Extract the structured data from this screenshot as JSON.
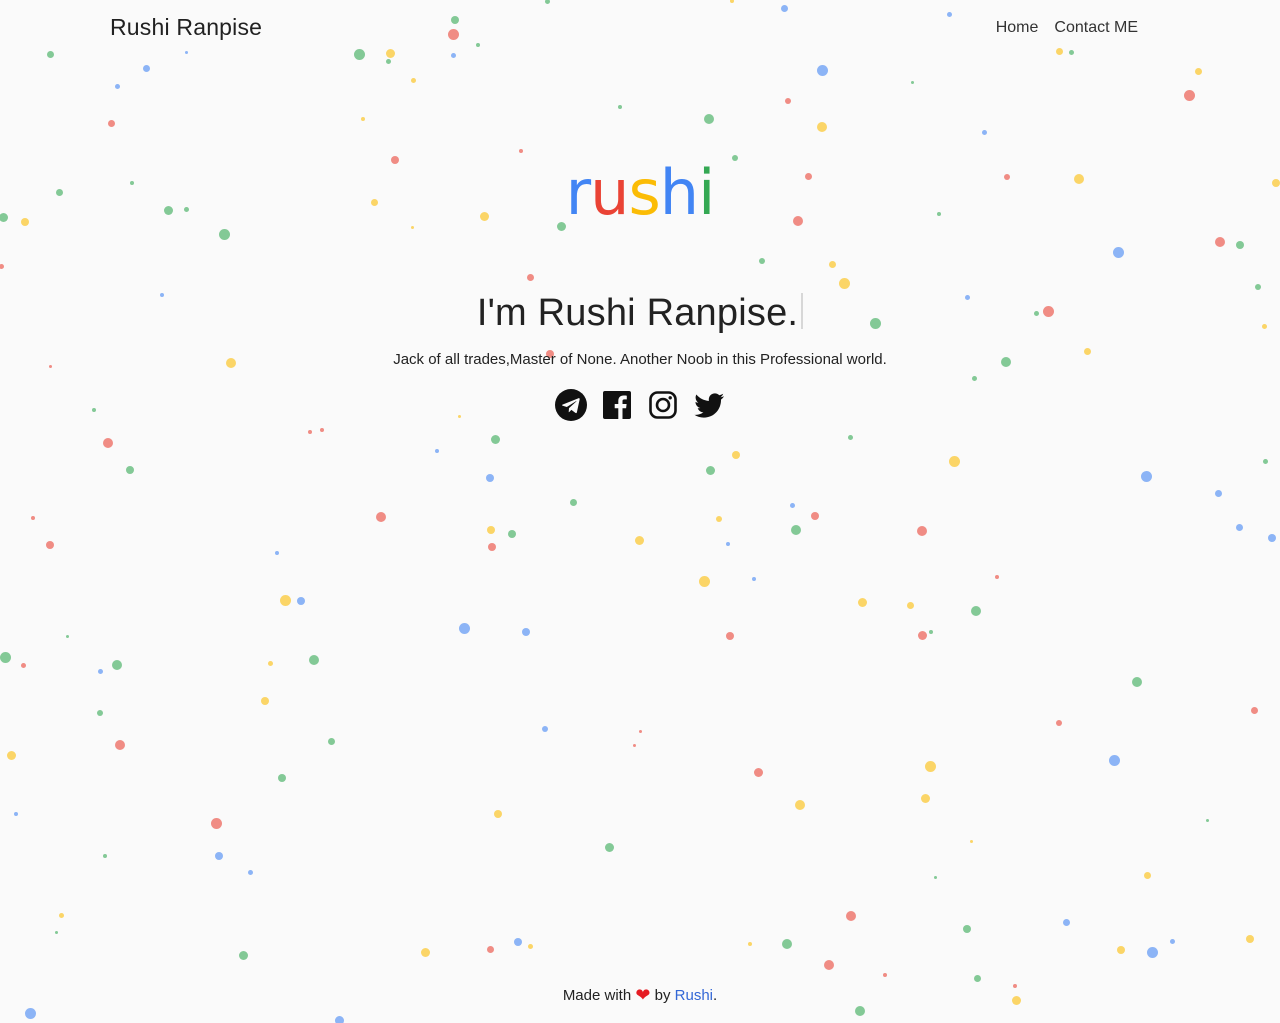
{
  "header": {
    "brand": "Rushi Ranpise",
    "nav": [
      {
        "label": "Home"
      },
      {
        "label": "Contact ME"
      }
    ]
  },
  "hero": {
    "logo_letters": [
      {
        "char": "r",
        "color": "#4285f4"
      },
      {
        "char": "u",
        "color": "#ea4335"
      },
      {
        "char": "s",
        "color": "#fbbc05"
      },
      {
        "char": "h",
        "color": "#4285f4"
      },
      {
        "char": "i",
        "color": "#34a853"
      }
    ],
    "headline": "I'm Rushi Ranpise.",
    "tagline": "Jack of all trades,Master of None. Another Noob in this Professional world.",
    "socials": [
      {
        "name": "telegram-icon"
      },
      {
        "name": "facebook-icon"
      },
      {
        "name": "instagram-icon"
      },
      {
        "name": "twitter-icon"
      }
    ]
  },
  "footer": {
    "made_with": "Made with",
    "by": "by",
    "author": "Rushi",
    "period": "."
  },
  "colors": {
    "red": "#ea4335",
    "blue": "#4285f4",
    "yellow": "#fbbc05",
    "green": "#34a853",
    "background": "#fafafa"
  }
}
